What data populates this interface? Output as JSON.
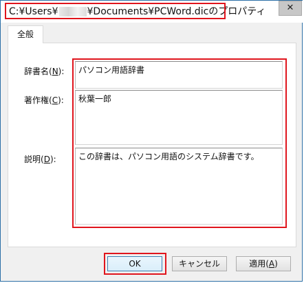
{
  "window": {
    "title_prefix": "C:¥Users¥",
    "title_suffix": "¥Documents¥PCWord.dicのプロパティ",
    "close_label": "✕"
  },
  "tabs": [
    {
      "label": "全般"
    }
  ],
  "fields": {
    "dict_name": {
      "label": "辞書名(",
      "key": "N",
      "label_end": "):",
      "value": "パソコン用語辞書"
    },
    "author": {
      "label": "著作権(",
      "key": "C",
      "label_end": "):",
      "value": "秋葉一郎"
    },
    "description": {
      "label": "説明(",
      "key": "D",
      "label_end": "):",
      "value": "この辞書は、パソコン用語のシステム辞書です。"
    }
  },
  "buttons": {
    "ok": "OK",
    "cancel": "キャンセル",
    "apply_label": "適用(",
    "apply_key": "A",
    "apply_end": ")"
  },
  "colors": {
    "highlight": "#e0141c",
    "window_border": "#2b6fa6",
    "panel_bg": "#ffffff",
    "dialog_bg": "#f0f0f0"
  }
}
